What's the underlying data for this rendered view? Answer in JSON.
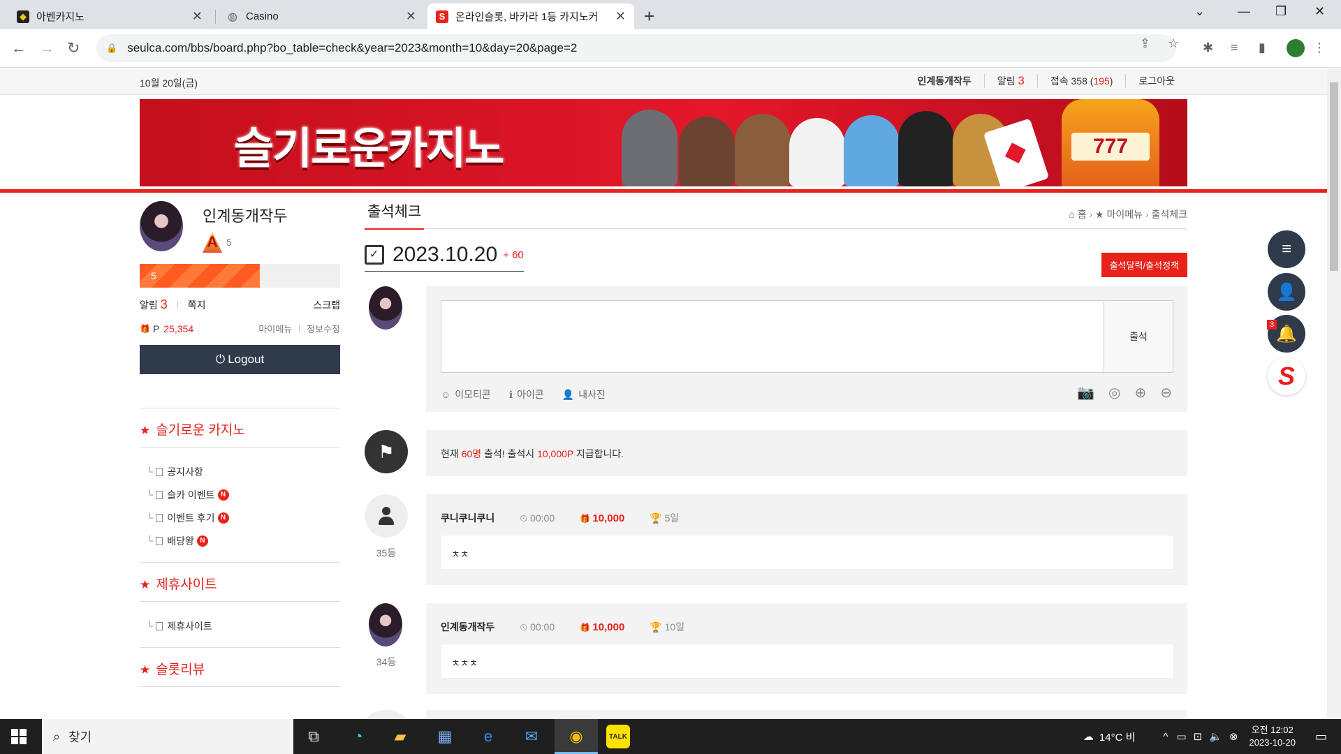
{
  "browser": {
    "tabs": [
      {
        "title": "아벤카지노",
        "active": false
      },
      {
        "title": "Casino",
        "active": false
      },
      {
        "title": "온라인슬롯, 바카라 1등 카지노커",
        "active": true
      }
    ],
    "url": "seulca.com/bbs/board.php?bo_table=check&year=2023&month=10&day=20&page=2"
  },
  "topbar": {
    "date": "10월 20일(금)",
    "nickname": "인계동개작두",
    "alerts_label": "알림",
    "alerts_count": "3",
    "visits_label": "접속 358 (",
    "visits_online": "195",
    "visits_close": ")",
    "logout": "로그아웃"
  },
  "banner": {
    "logo_text": "슬기로운카지노",
    "slot_digits": "777"
  },
  "sidebar": {
    "profile_name": "인계동개작두",
    "level_letter": "A",
    "level": "5",
    "exp_label": "5",
    "exp_percent": 60,
    "alerts_label": "알림",
    "alerts_count": "3",
    "memo": "쪽지",
    "scrap": "스크랩",
    "points_prefix": "P",
    "points": "25,354",
    "mymenu": "마이메뉴",
    "edit_info": "정보수정",
    "logout_button": "Logout",
    "sections": [
      {
        "title": "슬기로운 카지노",
        "items": [
          {
            "label": "공지사항",
            "new": false
          },
          {
            "label": "슬카 이벤트",
            "new": true
          },
          {
            "label": "이벤트 후기",
            "new": true
          },
          {
            "label": "배당왕",
            "new": true
          }
        ]
      },
      {
        "title": "제휴사이트",
        "items": [
          {
            "label": "제휴사이트",
            "new": false
          }
        ]
      },
      {
        "title": "슬롯리뷰",
        "items": []
      }
    ],
    "new_badge": "N"
  },
  "main": {
    "title": "출석체크",
    "breadcrumb": [
      "홈",
      "마이메뉴",
      "출석체크"
    ],
    "date": "2023.10.20",
    "date_plus": "+ 60",
    "calendar_button": "출석달력/출석정책",
    "submit_button": "출석",
    "tools": [
      "이모티콘",
      "아이콘",
      "내사진"
    ],
    "notice_prefix": "현재",
    "notice_count": "60명",
    "notice_mid": "출석! 출석시",
    "notice_points": "10,000P",
    "notice_suffix": "지급합니다.",
    "entries": [
      {
        "name": "쿠니쿠니쿠니",
        "time": "00:00",
        "points": "10,000",
        "days": "5일",
        "rank": "35등",
        "message": "ㅊㅊ"
      },
      {
        "name": "인계동개작두",
        "time": "00:00",
        "points": "10,000",
        "days": "10일",
        "rank": "34등",
        "message": "ㅊㅊㅊ"
      }
    ]
  },
  "fab": {
    "alert_count": "3",
    "logo_letter": "S"
  },
  "taskbar": {
    "search_placeholder": "찾기",
    "weather": "14°C  비",
    "time": "오전 12:02",
    "date": "2023-10-20"
  },
  "colors": {
    "accent": "#e8211b",
    "dark": "#2f3a4b"
  }
}
